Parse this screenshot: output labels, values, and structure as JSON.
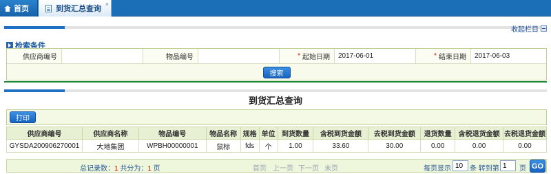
{
  "tabs": {
    "home_label": "首页",
    "active_label": "到货汇总查询",
    "close_glyph": "×"
  },
  "collapse_label": "收起栏目",
  "search": {
    "title": "检索条件",
    "supplier_code_label": "供应商编号",
    "supplier_code_value": "",
    "item_code_label": "物品编号",
    "item_code_value": "",
    "start_date_label": "起始日期",
    "start_date_value": "2017-06-01",
    "end_date_label": "结束日期",
    "end_date_value": "2017-06-03",
    "required_mark": "*",
    "button_label": "搜索"
  },
  "results": {
    "title": "到货汇总查询",
    "print_label": "打印",
    "columns": [
      "供应商编号",
      "供应商名称",
      "物品编号",
      "物品名称",
      "规格",
      "单位",
      "到货数量",
      "含税到货金额",
      "去税到货金额",
      "退货数量",
      "含税退货金额",
      "去税退货金额"
    ],
    "rows": [
      [
        "GYSDA200906270001",
        "大地集团",
        "WPBH00000001",
        "鼠标",
        "fds",
        "个",
        "1.00",
        "33.60",
        "30.00",
        "0.00",
        "0.00",
        "0.00"
      ]
    ]
  },
  "pager": {
    "total_prefix": "总记录数：",
    "total_count": "1",
    "pages_prefix": " 共分为：",
    "page_count": "1",
    "pages_suffix": " 页",
    "first": "首页",
    "prev": "上一页",
    "next": "下一页",
    "last": "末页",
    "per_page_label": "每页显示",
    "per_page_value": "10",
    "goto_label": "条 转到第",
    "goto_value": "1",
    "page_suffix": "页",
    "go_label": "GO"
  },
  "colors": {
    "tab_bar": "#1b6fb7",
    "button": "#1763c1",
    "grid_header": "#e7f0d3",
    "divider": "#1f8a3a"
  }
}
